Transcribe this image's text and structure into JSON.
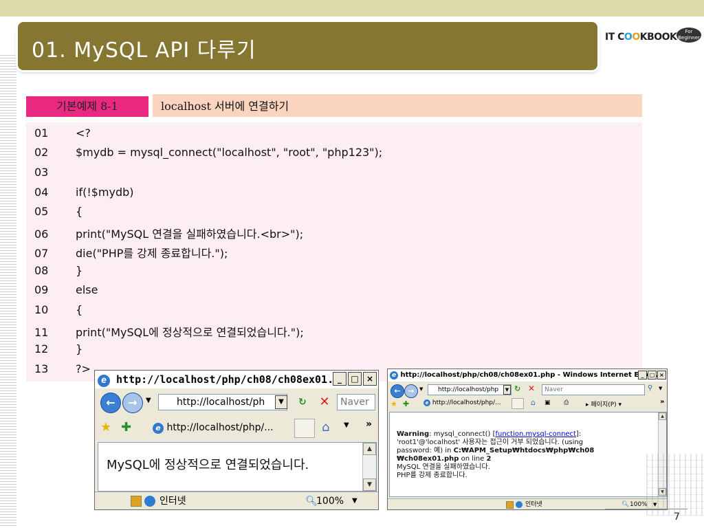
{
  "slide": {
    "title": "01.  MySQL API  다루기",
    "page_number": "7"
  },
  "logo": {
    "main_prefix": "IT C",
    "main_o1": "O",
    "main_o2": "O",
    "main_suffix": "KBOOK",
    "badge": "For Beginner"
  },
  "example": {
    "label": "기본예제 8-1",
    "title": "localhost 서버에 연결하기"
  },
  "code": [
    {
      "num": "01",
      "text": "<?"
    },
    {
      "num": "02",
      "text": "$mydb = mysql_connect(\"localhost\", \"root\", \"php123\");"
    },
    {
      "num": "03",
      "text": ""
    },
    {
      "num": "04",
      "text": "if(!$mydb)"
    },
    {
      "num": "05",
      "text": "{"
    },
    {
      "num": "06",
      "text": "print(\"MySQL 연결을 실패하였습니다.<br>\");"
    },
    {
      "num": "07",
      "text": "die(\"PHP를 강제 종료합니다.\");"
    },
    {
      "num": "08",
      "text": "}"
    },
    {
      "num": "09",
      "text": "else"
    },
    {
      "num": "10",
      "text": "{"
    },
    {
      "num": "11",
      "text": "print(\"MySQL에 정상적으로 연결되었습니다.\");"
    },
    {
      "num": "12",
      "text": "}"
    },
    {
      "num": "13",
      "text": "?>"
    }
  ],
  "win1": {
    "caption": "http://localhost/php/ch08/ch08ex01...",
    "address": "http://localhost/ph",
    "search_placeholder": "Naver",
    "tab_label": "http://localhost/php/...",
    "content_text": "MySQL에 정상적으로 연결되었습니다.",
    "status_zone": "인터넷",
    "zoom": "100%"
  },
  "win2": {
    "caption": "http://localhost/php/ch08/ch08ex01.php - Windows Internet Explo...",
    "address": "http://localhost/php",
    "search_placeholder": "Naver",
    "tab_label": "http://localhost/php/...",
    "page_menu": "페이지(P)",
    "warning_label": "Warning",
    "warning_pre": ": mysql_connect() [",
    "warning_link": "function.mysql-connect",
    "warning_post": "]:",
    "line2": "'root1'@'localhost' 사용자는 접근이 거부 되었습니다. (using",
    "line3_pre": "password: 예) in ",
    "line3_bold": "C:₩APM_Setup₩htdocs₩php₩ch08",
    "line4_bold": "₩ch08ex01.php",
    "line4_pre": " on line ",
    "line4_num": "2",
    "line5": "MySQL 연결을 실패하였습니다.",
    "line6": "PHP를 강제 종료합니다.",
    "status_zone": "인터넷",
    "zoom": "100%"
  }
}
